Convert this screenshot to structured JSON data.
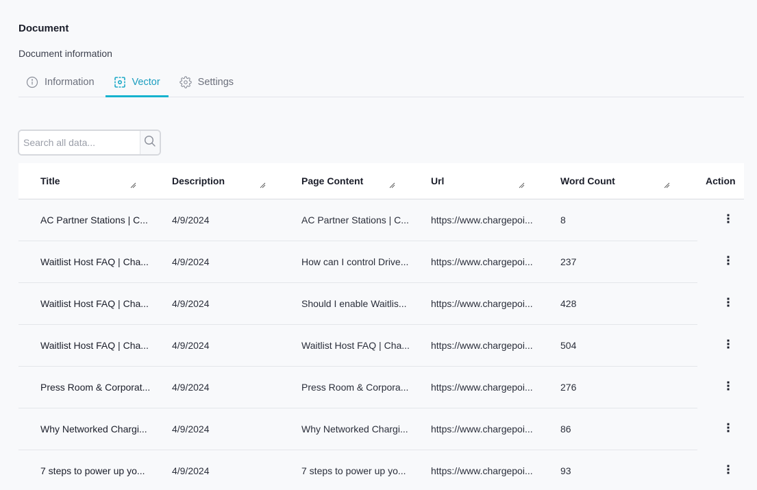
{
  "header": {
    "title": "Document",
    "subtitle": "Document information"
  },
  "tabs": [
    {
      "label": "Information",
      "icon": "info-circle-icon",
      "active": false
    },
    {
      "label": "Vector",
      "icon": "vector-scan-icon",
      "active": true
    },
    {
      "label": "Settings",
      "icon": "gear-icon",
      "active": false
    }
  ],
  "search": {
    "placeholder": "Search all data...",
    "value": "",
    "button_icon": "search-icon"
  },
  "colors": {
    "accent": "#16b3cf",
    "accent_text": "#1a9dbf"
  },
  "table": {
    "columns": [
      "Title",
      "Description",
      "Page Content",
      "Url",
      "Word Count",
      "Action"
    ],
    "rows": [
      {
        "title": "AC Partner Stations | C...",
        "description": "4/9/2024",
        "page_content": "AC Partner Stations | C...",
        "url": "https://www.chargepoi...",
        "word_count": "8"
      },
      {
        "title": "Waitlist Host FAQ | Cha...",
        "description": "4/9/2024",
        "page_content": "How can I control Drive...",
        "url": "https://www.chargepoi...",
        "word_count": "237"
      },
      {
        "title": "Waitlist Host FAQ | Cha...",
        "description": "4/9/2024",
        "page_content": "Should I enable Waitlis...",
        "url": "https://www.chargepoi...",
        "word_count": "428"
      },
      {
        "title": "Waitlist Host FAQ | Cha...",
        "description": "4/9/2024",
        "page_content": "Waitlist Host FAQ | Cha...",
        "url": "https://www.chargepoi...",
        "word_count": "504"
      },
      {
        "title": "Press Room & Corporat...",
        "description": "4/9/2024",
        "page_content": "Press Room & Corpora...",
        "url": "https://www.chargepoi...",
        "word_count": "276"
      },
      {
        "title": "Why Networked Chargi...",
        "description": "4/9/2024",
        "page_content": "Why Networked Chargi...",
        "url": "https://www.chargepoi...",
        "word_count": "86"
      },
      {
        "title": "7 steps to power up yo...",
        "description": "4/9/2024",
        "page_content": "7 steps to power up yo...",
        "url": "https://www.chargepoi...",
        "word_count": "93"
      }
    ]
  }
}
